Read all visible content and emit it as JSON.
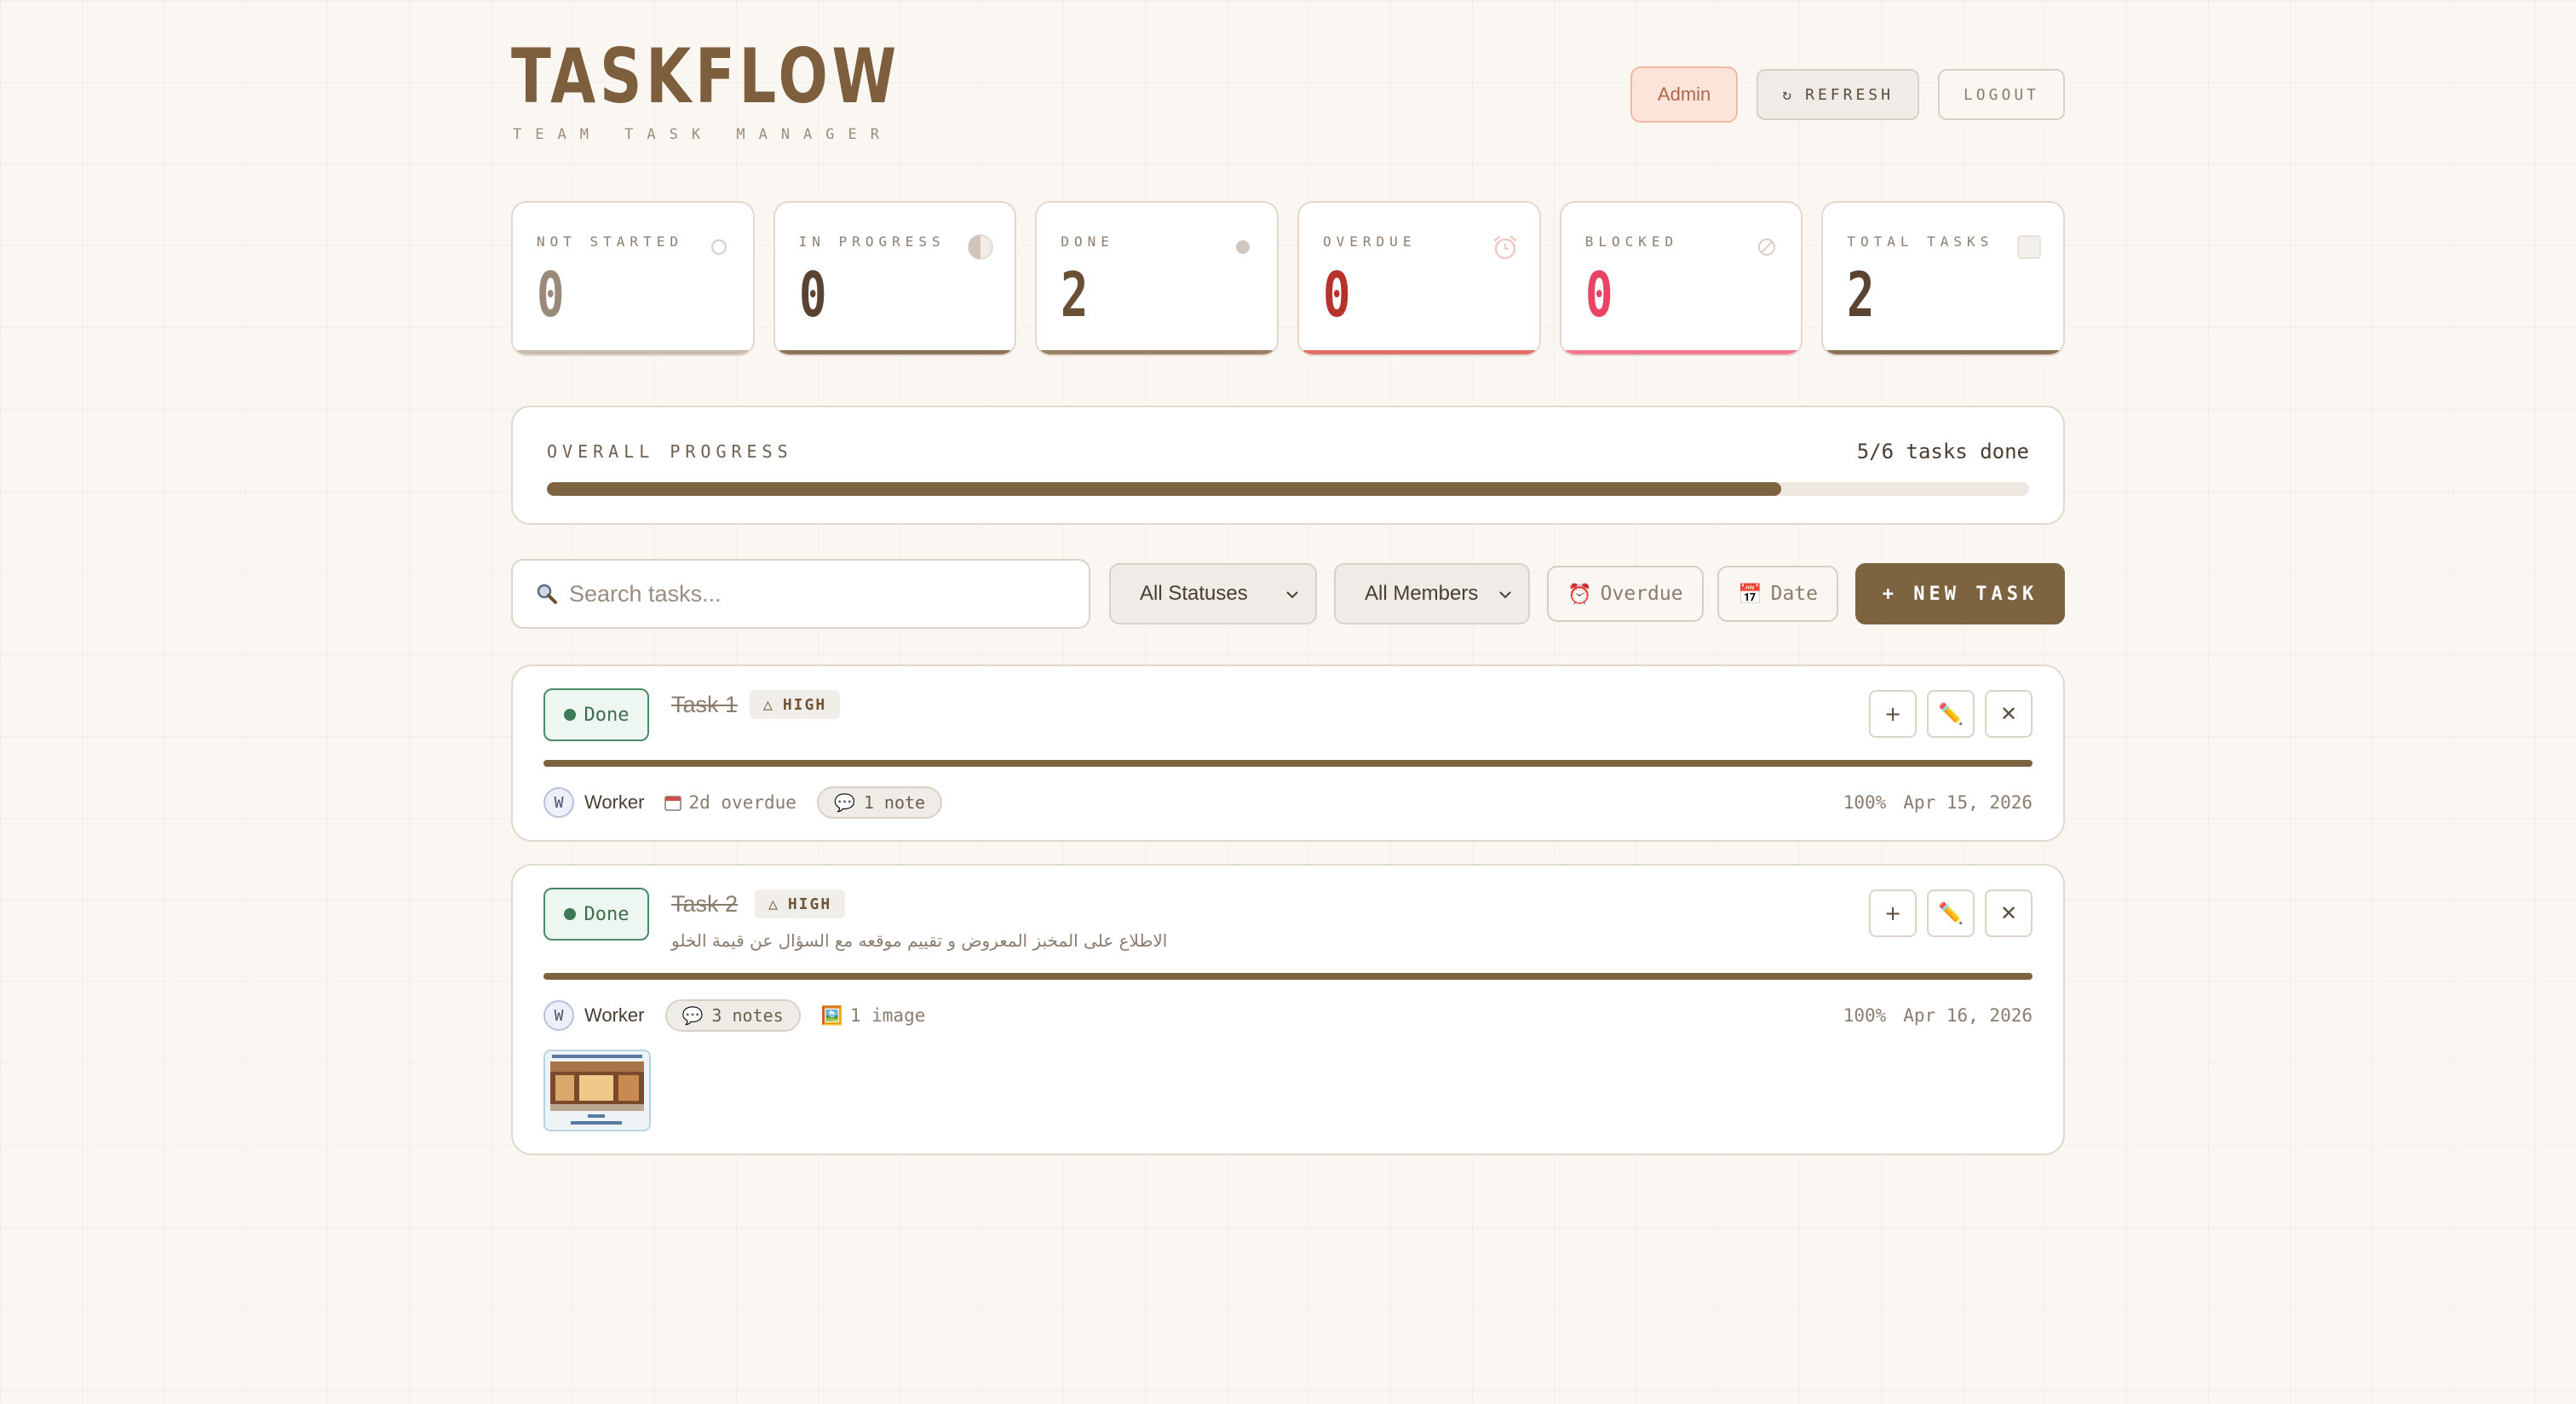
{
  "app": {
    "title": "TASKFLOW",
    "subtitle": "TEAM TASK MANAGER"
  },
  "header": {
    "role_label": "Admin",
    "refresh_icon": "↻",
    "refresh_label": "REFRESH",
    "logout_label": "LOGOUT"
  },
  "stats": [
    {
      "label": "NOT STARTED",
      "value": "0",
      "icon": "circle-outline-icon",
      "value_color": "#9a8a7a",
      "accent": "#c9bcae"
    },
    {
      "label": "IN PROGRESS",
      "value": "0",
      "icon": "half-circle-icon",
      "value_color": "#5a4330",
      "accent": "#8c7356"
    },
    {
      "label": "DONE",
      "value": "2",
      "icon": "filled-dot-icon",
      "value_color": "#6a5136",
      "accent": "#9a8064"
    },
    {
      "label": "OVERDUE",
      "value": "0",
      "icon": "alarm-clock-icon",
      "value_color": "#b8322c",
      "accent": "#e06f6a"
    },
    {
      "label": "BLOCKED",
      "value": "0",
      "icon": "blocked-icon",
      "value_color": "#e94464",
      "accent": "#f07a92"
    },
    {
      "label": "TOTAL TASKS",
      "value": "2",
      "icon": "square-icon",
      "value_color": "#5a4330",
      "accent": "#8c7356"
    }
  ],
  "progress": {
    "label": "OVERALL PROGRESS",
    "count_text": "5/6 tasks done",
    "percent": 83.3
  },
  "toolbar": {
    "search_placeholder": "Search tasks...",
    "status_filter": "All Statuses",
    "member_filter": "All Members",
    "overdue_icon": "⏰",
    "overdue_label": "Overdue",
    "date_icon": "📅",
    "date_label": "Date",
    "new_task_label": "+ NEW TASK"
  },
  "tasks": [
    {
      "status": "Done",
      "title": "Task 1",
      "priority": "HIGH",
      "priority_icon": "△",
      "description": "",
      "progress_percent": 100,
      "assignee_initial": "W",
      "assignee": "Worker",
      "overdue_text": "2d overdue",
      "notes_text": "1 note",
      "percent_text": "100%",
      "date": "Apr 15, 2026",
      "action_add": "+",
      "action_edit": "✏️",
      "action_delete": "✕"
    },
    {
      "status": "Done",
      "title": "Task 2",
      "priority": "HIGH",
      "priority_icon": "△",
      "description": "الاطلاع على المخبز المعروض و تقييم موقعه مع السؤال عن قيمة الخلو",
      "progress_percent": 100,
      "assignee_initial": "W",
      "assignee": "Worker",
      "notes_text": "3 notes",
      "image_icon": "🖼️",
      "image_text": "1 image",
      "percent_text": "100%",
      "date": "Apr 16, 2026",
      "action_add": "+",
      "action_edit": "✏️",
      "action_delete": "✕"
    }
  ],
  "colors": {
    "brand": "#7d5f3d",
    "primary_button": "#7d6340",
    "done_green": "#3f7a56",
    "background": "#faf7f3"
  }
}
